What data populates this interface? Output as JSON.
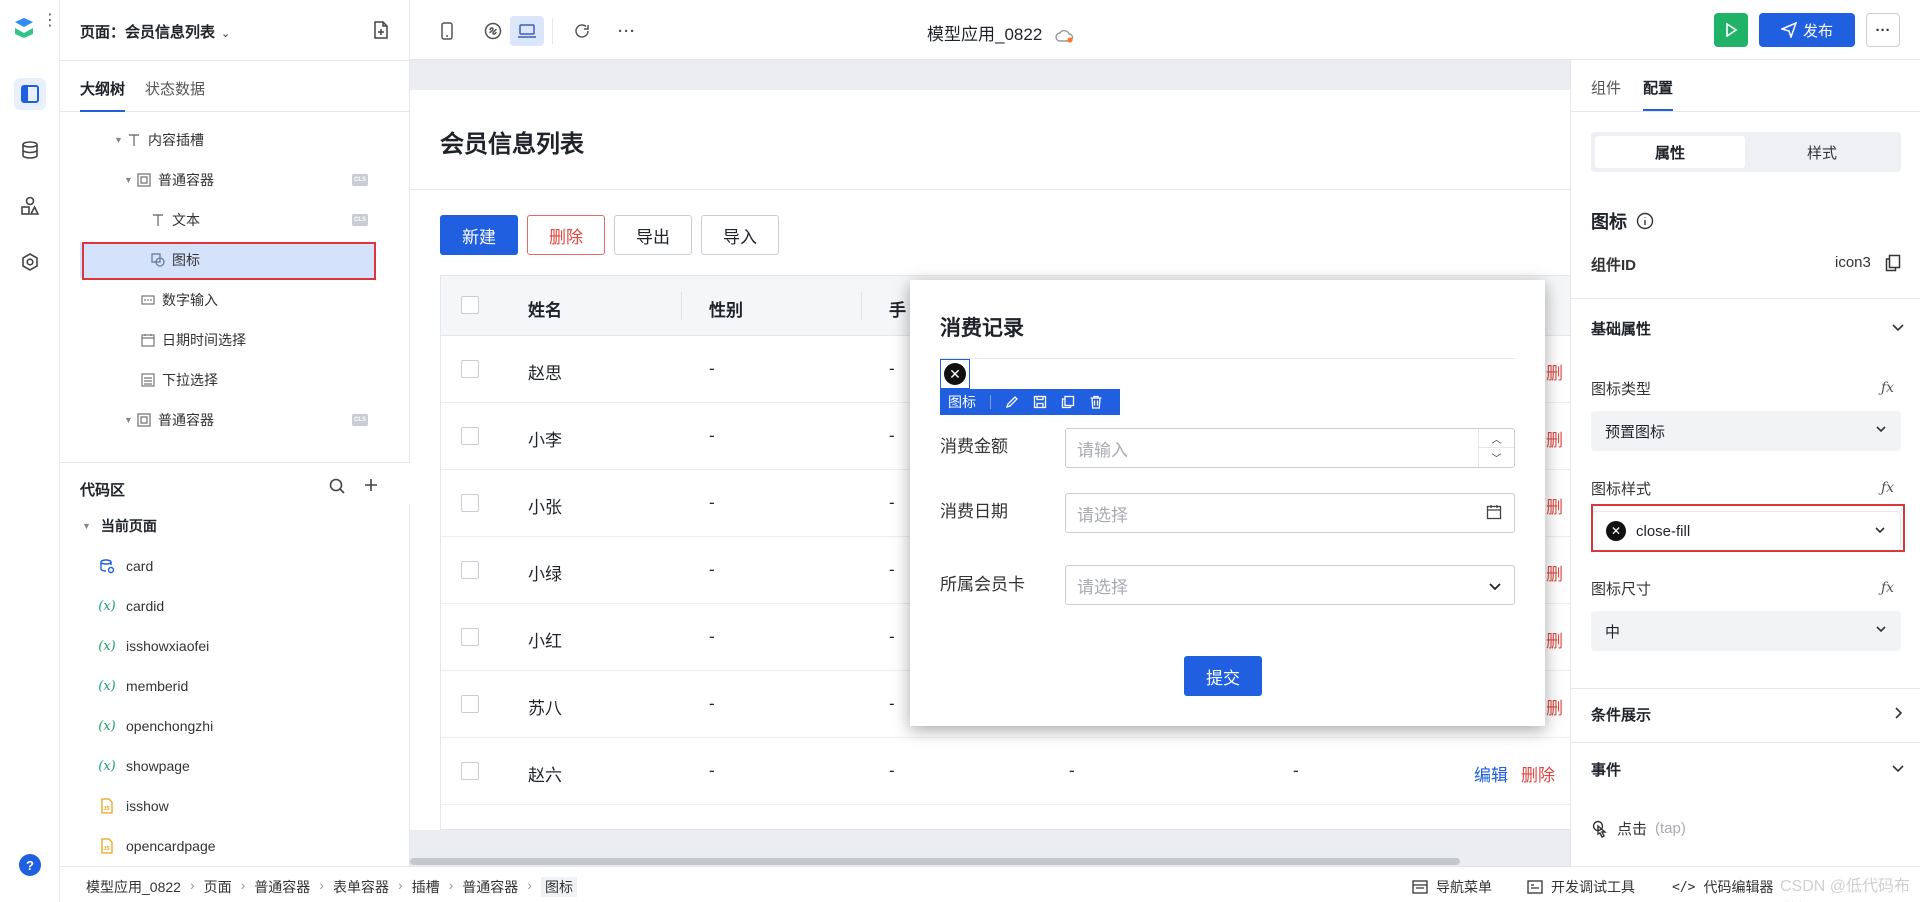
{
  "page_selector": {
    "label": "页面：会员信息列表"
  },
  "left_tabs": [
    "大纲树",
    "状态数据"
  ],
  "outline": [
    {
      "label": "内容插槽",
      "icon": "text-icon"
    },
    {
      "label": "普通容器",
      "icon": "container-icon"
    },
    {
      "label": "文本",
      "icon": "text-icon"
    },
    {
      "label": "图标",
      "icon": "icon-component-icon"
    },
    {
      "label": "数字输入",
      "icon": "number-input-icon"
    },
    {
      "label": "日期时间选择",
      "icon": "calendar-icon"
    },
    {
      "label": "下拉选择",
      "icon": "select-icon"
    },
    {
      "label": "普通容器",
      "icon": "container-icon"
    }
  ],
  "code": {
    "title": "代码区",
    "group": "当前页面",
    "items": [
      {
        "label": "card",
        "type": "datasource"
      },
      {
        "label": "cardid",
        "type": "var"
      },
      {
        "label": "isshowxiaofei",
        "type": "var"
      },
      {
        "label": "memberid",
        "type": "var"
      },
      {
        "label": "openchongzhi",
        "type": "var"
      },
      {
        "label": "showpage",
        "type": "var"
      },
      {
        "label": "isshow",
        "type": "js"
      },
      {
        "label": "opencardpage",
        "type": "js"
      }
    ]
  },
  "topbar": {
    "app_title": "模型应用_0822",
    "publish": "发布"
  },
  "canvas": {
    "page_title": "会员信息列表",
    "buttons": {
      "new": "新建",
      "delete": "删除",
      "export": "导出",
      "import": "导入"
    },
    "columns": [
      "姓名",
      "性别",
      "手"
    ],
    "rows": [
      {
        "name": "赵思",
        "gender": "-",
        "phone": "-",
        "act_del": "删"
      },
      {
        "name": "小李",
        "gender": "-",
        "phone": "-",
        "act_del": "删"
      },
      {
        "name": "小张",
        "gender": "-",
        "phone": "-",
        "act_del": "删"
      },
      {
        "name": "小绿",
        "gender": "-",
        "phone": "-",
        "act_del": "删"
      },
      {
        "name": "小红",
        "gender": "-",
        "phone": "-",
        "act_del": "删"
      },
      {
        "name": "苏八",
        "gender": "-",
        "phone": "-",
        "act_del": "删"
      }
    ],
    "last_row": {
      "name": "赵六",
      "gender": "-",
      "phone": "-",
      "c4": "-",
      "c5": "-",
      "edit": "编辑",
      "del": "删除"
    }
  },
  "dialog": {
    "title": "消费记录",
    "toolbar_label": "图标",
    "fields": [
      {
        "label": "消费金额",
        "placeholder": "请输入"
      },
      {
        "label": "消费日期",
        "placeholder": "请选择"
      },
      {
        "label": "所属会员卡",
        "placeholder": "请选择"
      }
    ],
    "submit": "提交"
  },
  "right": {
    "tabs": [
      "组件",
      "配置"
    ],
    "segment": [
      "属性",
      "样式"
    ],
    "component_title": "图标",
    "component_id_label": "组件ID",
    "component_id": "icon3",
    "basic_props": "基础属性",
    "icon_type_label": "图标类型",
    "icon_type": "预置图标",
    "icon_style_label": "图标样式",
    "icon_style": "close-fill",
    "icon_size_label": "图标尺寸",
    "icon_size": "中",
    "condition": "条件展示",
    "events": "事件",
    "tap_event": "点击",
    "tap_event_hint": "(tap)"
  },
  "breadcrumb": [
    "模型应用_0822",
    "页面",
    "普通容器",
    "表单容器",
    "插槽",
    "普通容器",
    "图标"
  ],
  "status_bar": {
    "nav_menu": "导航菜单",
    "dev_tools": "开发调试工具",
    "code_editor": "代码编辑器"
  },
  "watermark": "CSDN @低代码布道师",
  "colors": {
    "primary": "#1f5fe0",
    "danger": "#e0453f",
    "success": "#20b368",
    "highlight": "#d9363e"
  }
}
